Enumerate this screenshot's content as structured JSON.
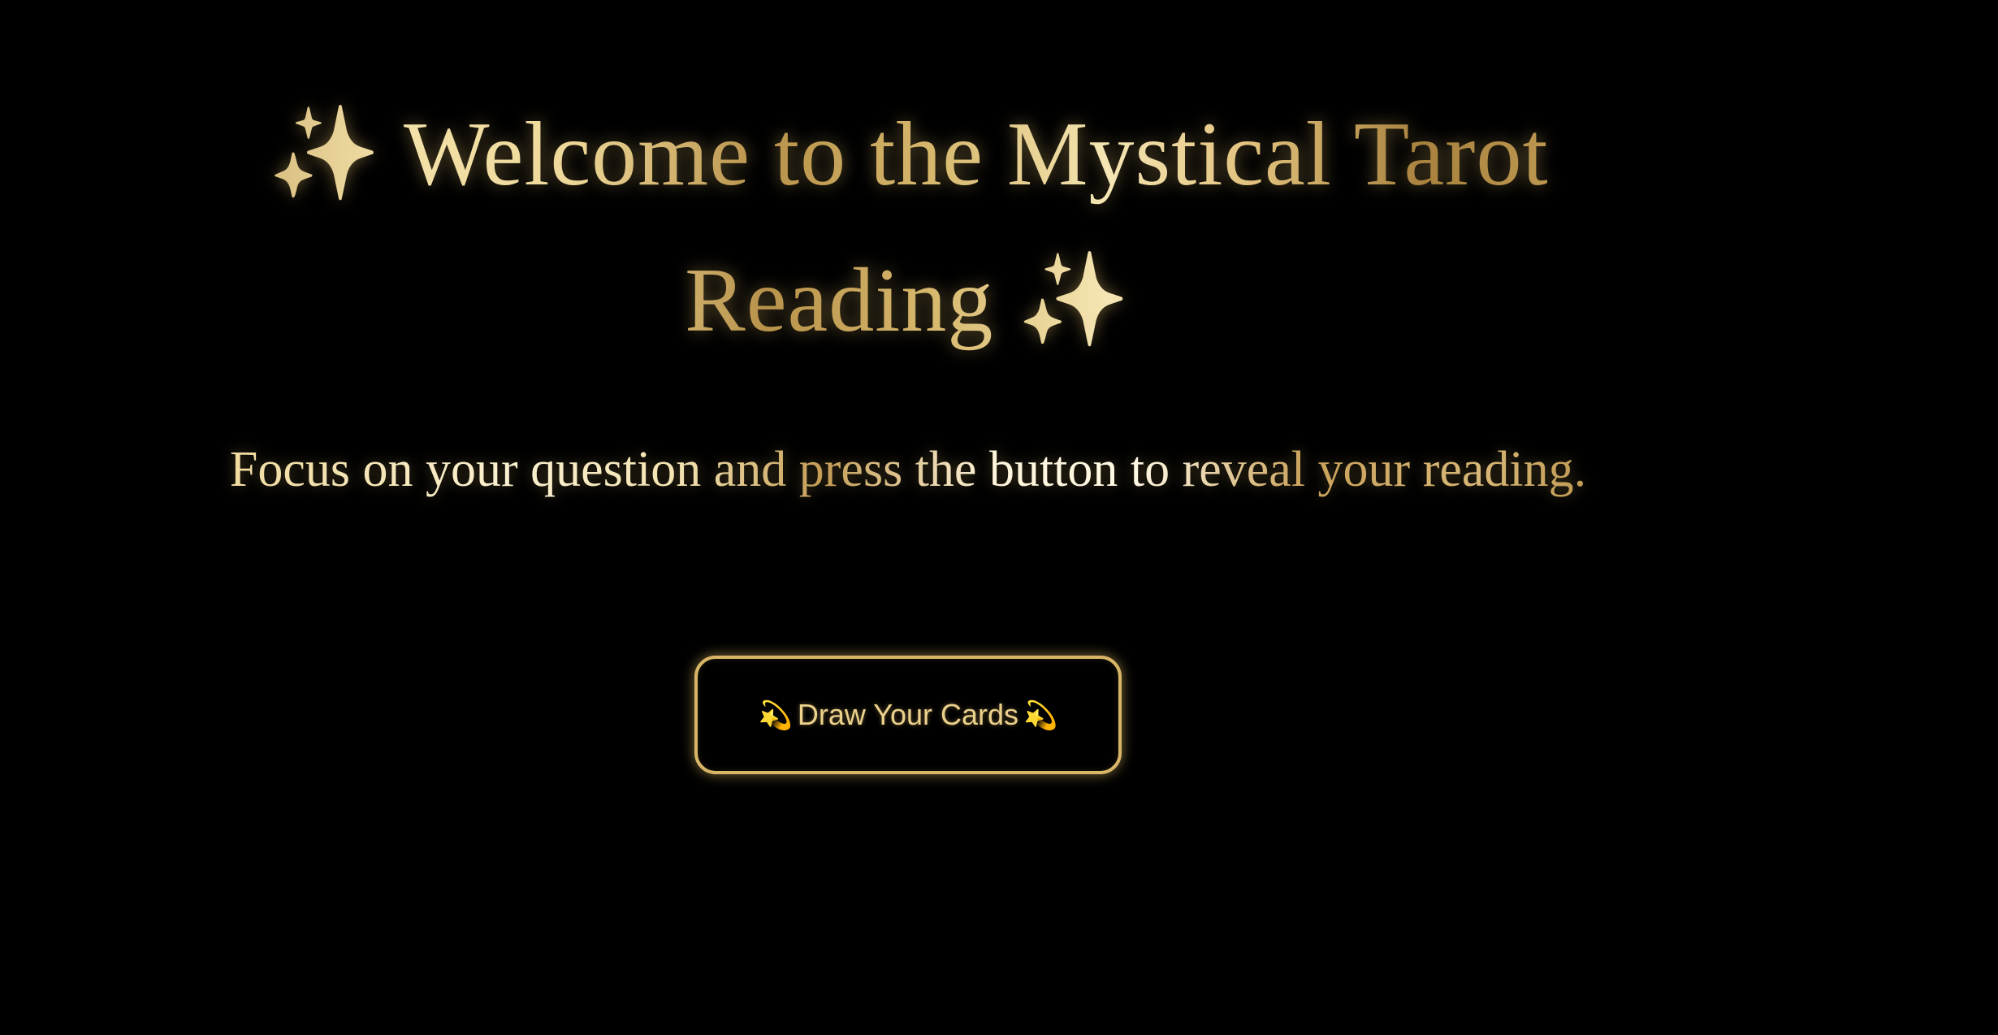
{
  "hero": {
    "title": "✨ Welcome to the Mystical Tarot Reading ✨",
    "tagline": "Focus on your question and press the button to reveal your reading."
  },
  "draw_button": {
    "icon_left": "💫",
    "label": "Draw Your Cards",
    "icon_right": "💫",
    "icon_name": "dizzy-star-icon"
  },
  "colors": {
    "background": "#000000",
    "gold": "#e9cf8c",
    "gold_dark": "#b8924a",
    "button_border": "#d9b667"
  }
}
